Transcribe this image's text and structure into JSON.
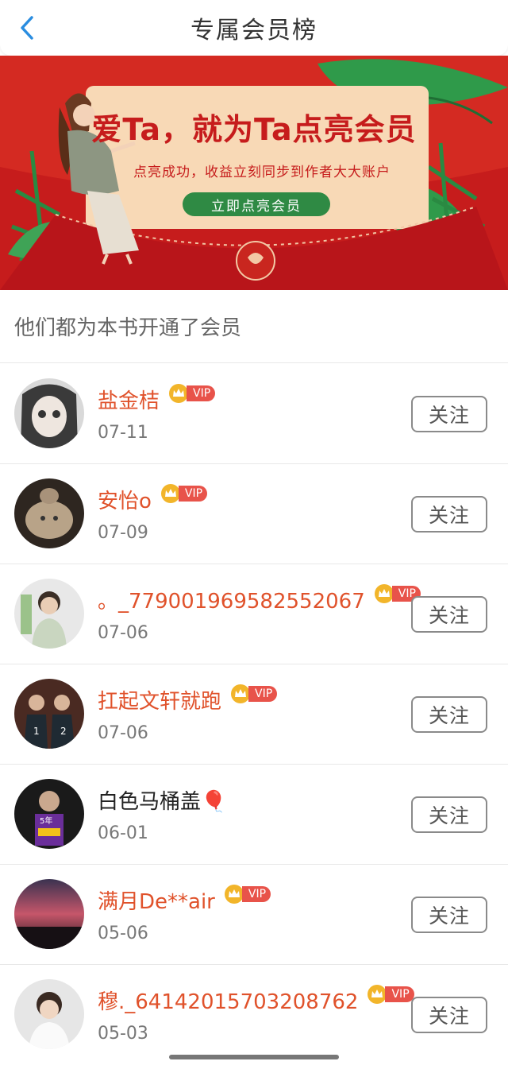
{
  "header": {
    "title": "专属会员榜"
  },
  "banner": {
    "headline": "爱Ta，就为Ta点亮会员",
    "subline": "点亮成功，收益立刻同步到作者大大账户",
    "cta": "立即点亮会员"
  },
  "section": {
    "title": "他们都为本书开通了会员"
  },
  "vip_label": "VIP",
  "follow_label": "关注",
  "members": [
    {
      "name": "盐金桔",
      "date": "07-11",
      "vip": true
    },
    {
      "name": "安怡o",
      "date": "07-09",
      "vip": true
    },
    {
      "name": "。_779001969582552067",
      "date": "07-06",
      "vip": true
    },
    {
      "name": "扛起文轩就跑",
      "date": "07-06",
      "vip": true
    },
    {
      "name": "白色马桶盖🎈",
      "date": "06-01",
      "vip": false
    },
    {
      "name": "满月De**air",
      "date": "05-06",
      "vip": true
    },
    {
      "name": "穆._641420157032087​62",
      "date": "05-03",
      "vip": true
    }
  ],
  "colors": {
    "accent": "#e0522b",
    "banner_red": "#c61c1c",
    "vip_red": "#e8534a",
    "crown_gold": "#f2b52a"
  }
}
